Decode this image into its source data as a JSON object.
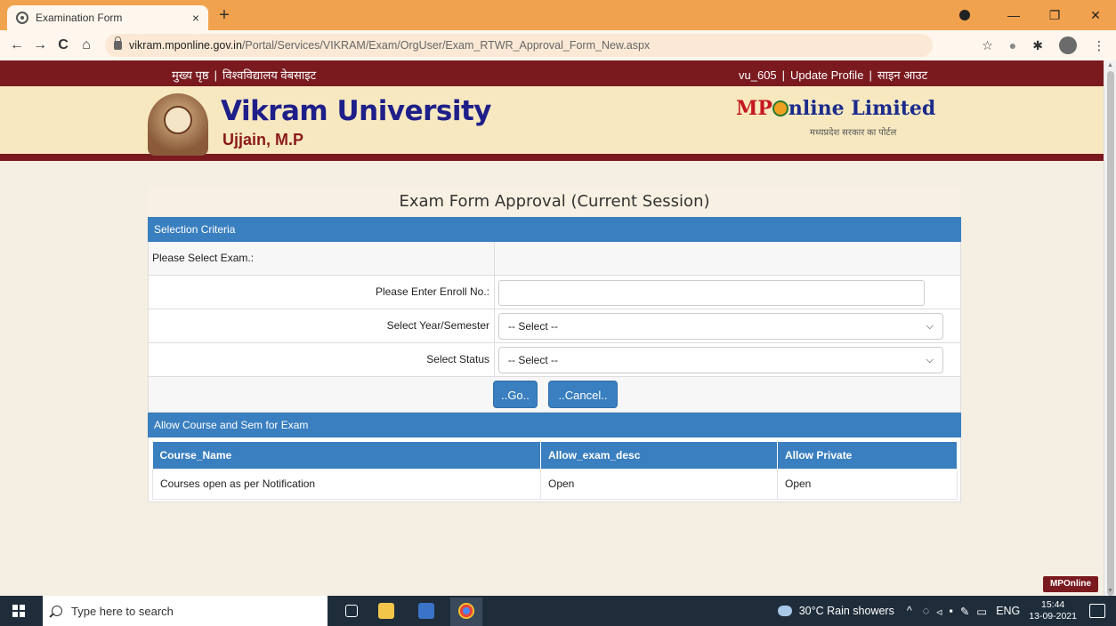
{
  "browser": {
    "tab_title": "Examination Form",
    "tab_close": "×",
    "new_tab": "+",
    "url_host": "vikram.mponline.gov.in",
    "url_path": "/Portal/Services/VIKRAM/Exam/OrgUser/Exam_RTWR_Approval_Form_New.aspx",
    "back": "←",
    "forward": "→",
    "reload": "C",
    "home": "⌂",
    "star": "☆",
    "menu": "⋮",
    "minimize": "—",
    "restore": "❐",
    "close": "✕"
  },
  "topbar": {
    "home_link": "मुख्य पृष्ठ",
    "univ_site_link": "विश्वविद्यालय वेबसाइट",
    "user_id": "vu_605",
    "update_profile": "Update Profile",
    "logout": "साइन आउट",
    "sep": "|"
  },
  "banner": {
    "university_name": "Vikram University",
    "university_city": "Ujjain, M.P",
    "mponline_mp": "MP",
    "mponline_rest": "nline Limited",
    "mponline_tagline": "मध्यप्रदेश सरकार का पोर्टल"
  },
  "form": {
    "title": "Exam Form Approval (Current Session)",
    "selection_header": "Selection Criteria",
    "exam_label": "Please Select Exam.:",
    "enroll_label": "Please Enter Enroll No.:",
    "enroll_value": "",
    "year_label": "Select Year/Semester",
    "year_value": "-- Select --",
    "status_label": "Select Status",
    "status_value": "-- Select --",
    "go_button": "..Go..",
    "cancel_button": "..Cancel.."
  },
  "allow_section": {
    "header": "Allow Course and Sem for Exam",
    "columns": [
      "Course_Name",
      "Allow_exam_desc",
      "Allow Private"
    ],
    "rows": [
      [
        "Courses open as per Notification",
        "Open",
        "Open"
      ]
    ]
  },
  "badge": "MPOnline",
  "taskbar": {
    "search_placeholder": "Type here to search",
    "weather": "30°C  Rain showers",
    "lang": "ENG",
    "time": "15:44",
    "date": "13-09-2021"
  }
}
